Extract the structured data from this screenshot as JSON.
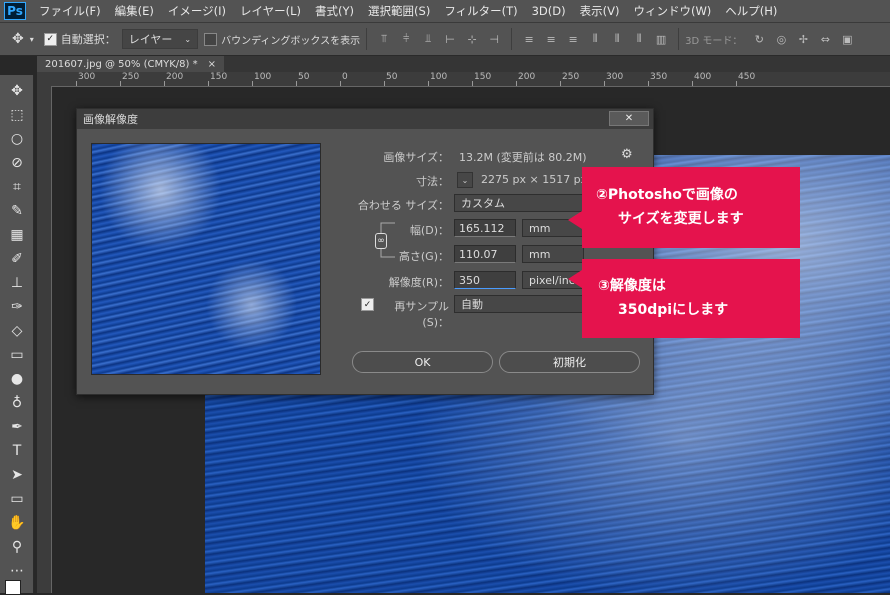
{
  "app": {
    "logo": "Ps"
  },
  "menu": [
    "ファイル(F)",
    "編集(E)",
    "イメージ(I)",
    "レイヤー(L)",
    "書式(Y)",
    "選択範囲(S)",
    "フィルター(T)",
    "3D(D)",
    "表示(V)",
    "ウィンドウ(W)",
    "ヘルプ(H)"
  ],
  "options": {
    "auto_select_label": "自動選択：",
    "auto_select_target": "レイヤー",
    "bounding_box_label": "バウンディングボックスを表示",
    "mode_3d_label": "3D モード："
  },
  "document": {
    "tab_title": "201607.jpg @ 50% (CMYK/8) *",
    "tab_close": "×"
  },
  "ruler": {
    "ticks": [
      "300",
      "250",
      "200",
      "150",
      "100",
      "50",
      "0",
      "50",
      "100",
      "150",
      "200",
      "250",
      "300",
      "350",
      "400",
      "450"
    ]
  },
  "dialog": {
    "title": "画像解像度",
    "close_glyph": "✕",
    "image_size_label": "画像サイズ：",
    "image_size_value": "13.2M (変更前は 80.2M)",
    "dimensions_label": "寸法：",
    "dimensions_value": "2275 px × 1517 px",
    "fit_label": "合わせる サイズ：",
    "fit_value": "カスタム",
    "width_label": "幅(D)：",
    "width_value": "165.112",
    "width_unit": "mm",
    "height_label": "高さ(G)：",
    "height_value": "110.07",
    "height_unit": "mm",
    "resolution_label": "解像度(R)：",
    "resolution_value": "350",
    "resolution_unit": "pixel/inch",
    "resample_label": "再サンプル(S)：",
    "resample_value": "自動",
    "ok_label": "OK",
    "reset_label": "初期化"
  },
  "callouts": {
    "c2_line1": "②Photoshoで画像の",
    "c2_line2": "サイズを変更します",
    "c3_line1": "③解像度は",
    "c3_line2": "350dpiにします"
  },
  "colors": {
    "callout": "#e5134d",
    "ui_bg": "#535353"
  }
}
